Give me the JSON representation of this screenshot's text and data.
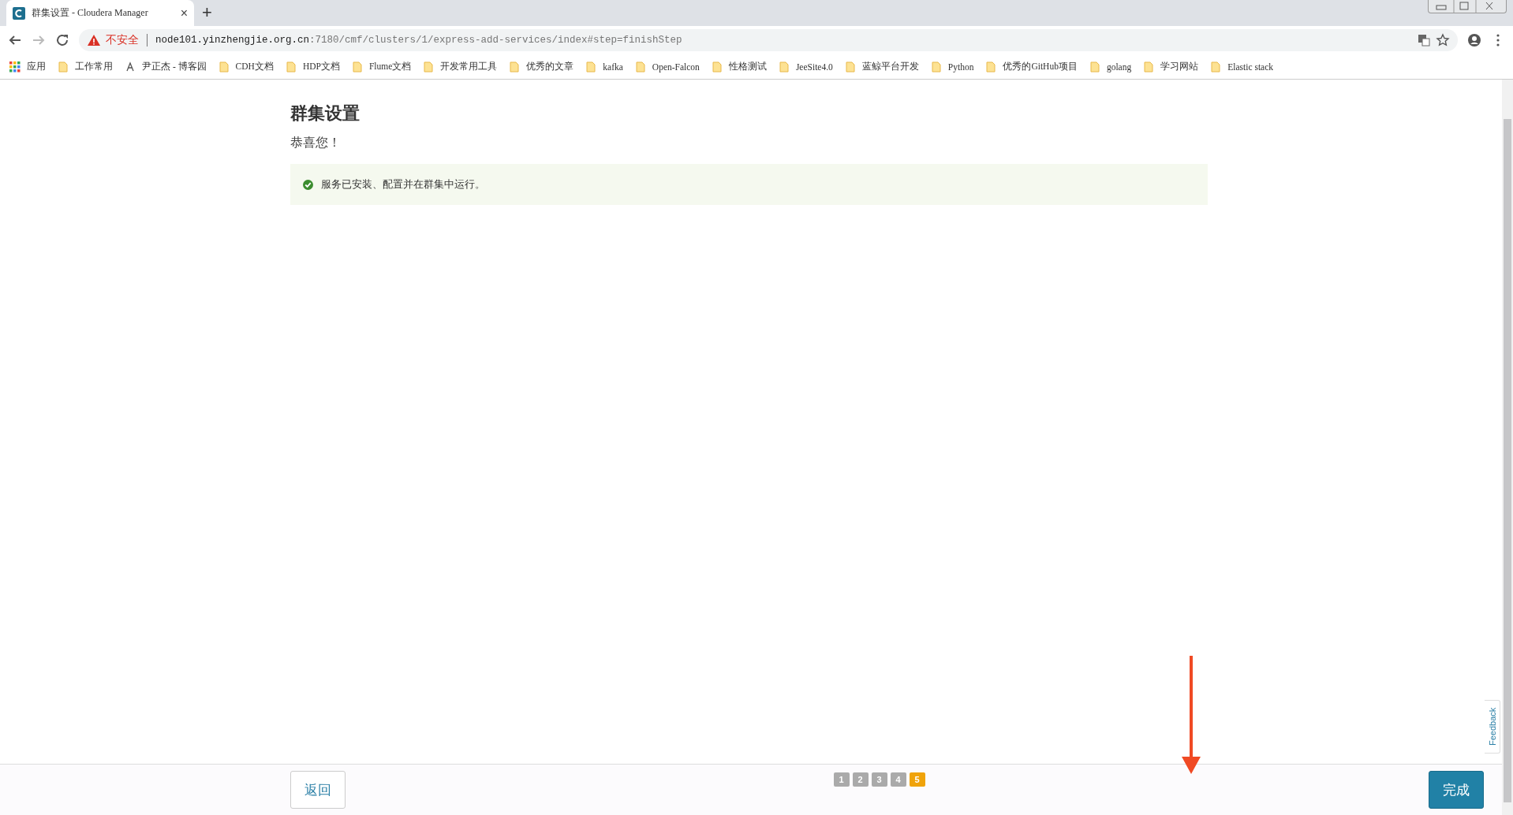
{
  "browser": {
    "tab": {
      "title": "群集设置 - Cloudera Manager",
      "close": "×"
    },
    "new_tab": "+",
    "address": {
      "security": "不安全",
      "host": "node101.yinzhengjie.org.cn",
      "path": ":7180/cmf/clusters/1/express-add-services/index#step=finishStep"
    },
    "bookmarks": [
      {
        "label": "应用",
        "kind": "apps"
      },
      {
        "label": "工作常用",
        "kind": "folder"
      },
      {
        "label": "尹正杰 - 博客园",
        "kind": "site"
      },
      {
        "label": "CDH文档",
        "kind": "folder"
      },
      {
        "label": "HDP文档",
        "kind": "folder"
      },
      {
        "label": "Flume文档",
        "kind": "folder"
      },
      {
        "label": "开发常用工具",
        "kind": "folder"
      },
      {
        "label": "优秀的文章",
        "kind": "folder"
      },
      {
        "label": "kafka",
        "kind": "folder"
      },
      {
        "label": "Open-Falcon",
        "kind": "folder"
      },
      {
        "label": "性格测试",
        "kind": "folder"
      },
      {
        "label": "JeeSite4.0",
        "kind": "folder"
      },
      {
        "label": "蓝鲸平台开发",
        "kind": "folder"
      },
      {
        "label": "Python",
        "kind": "folder"
      },
      {
        "label": "优秀的GitHub项目",
        "kind": "folder"
      },
      {
        "label": "golang",
        "kind": "folder"
      },
      {
        "label": "学习网站",
        "kind": "folder"
      },
      {
        "label": "Elastic stack",
        "kind": "folder"
      }
    ]
  },
  "page": {
    "title": "群集设置",
    "subtitle": "恭喜您！",
    "alert": "服务已安装、配置并在群集中运行。",
    "back": "返回",
    "steps": [
      {
        "label": "1",
        "selected": false
      },
      {
        "label": "2",
        "selected": false
      },
      {
        "label": "3",
        "selected": false
      },
      {
        "label": "4",
        "selected": false
      },
      {
        "label": "5",
        "selected": true
      }
    ],
    "finish": "完成"
  },
  "feedback": "Feedback"
}
